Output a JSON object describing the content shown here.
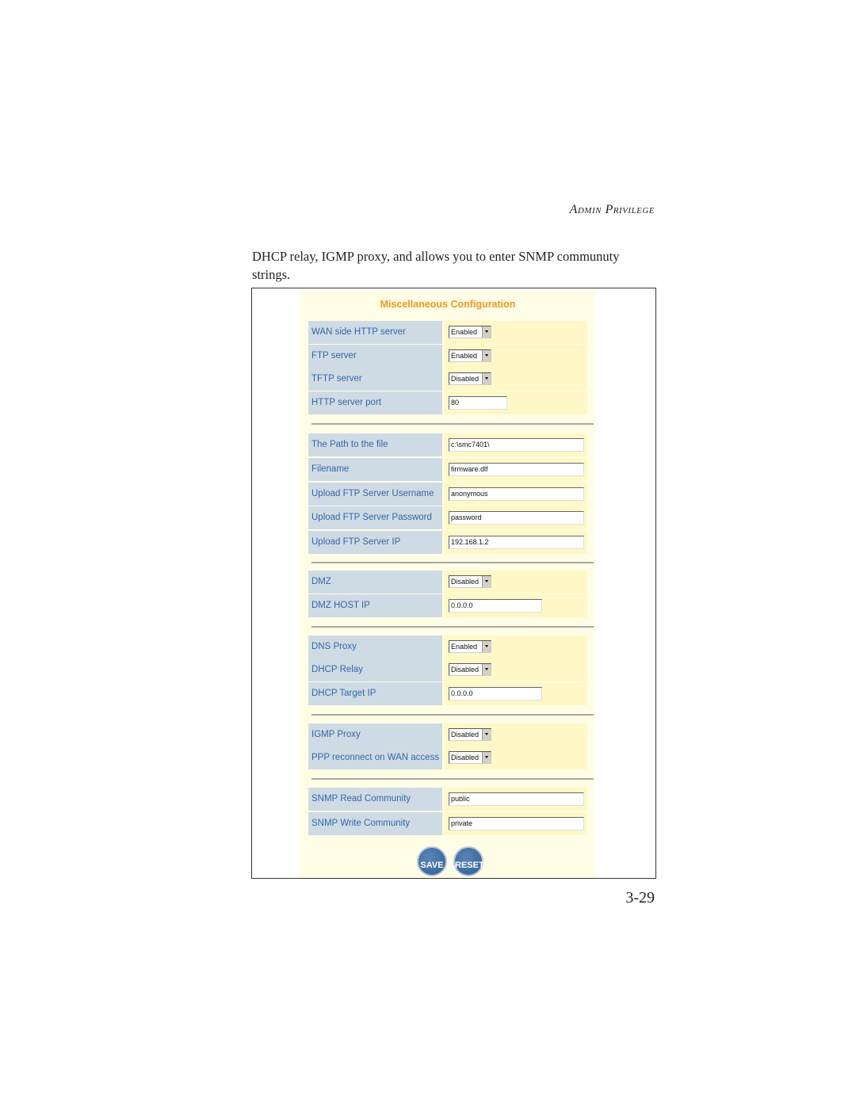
{
  "running_head": "Admin Privilege",
  "intro_text": "DHCP relay, IGMP proxy, and allows you to enter SNMP communuty strings.",
  "panel": {
    "title": "Miscellaneous Configuration",
    "rows": [
      {
        "label": "WAN side HTTP server",
        "type": "select",
        "value": "Enabled"
      },
      {
        "label": "FTP server",
        "type": "select",
        "value": "Enabled"
      },
      {
        "label": "TFTP server",
        "type": "select",
        "value": "Disabled"
      },
      {
        "label": "HTTP server port",
        "type": "text",
        "value": "80"
      },
      {
        "label": "The Path to the file",
        "type": "text",
        "value": "c:\\smc7401\\"
      },
      {
        "label": "Filename",
        "type": "text",
        "value": "firmware.dlf"
      },
      {
        "label": "Upload FTP Server Username",
        "type": "text",
        "value": "anonymous"
      },
      {
        "label": "Upload FTP Server Password",
        "type": "text",
        "value": "password"
      },
      {
        "label": "Upload FTP Server IP",
        "type": "text",
        "value": "192.168.1.2"
      },
      {
        "label": "DMZ",
        "type": "select",
        "value": "Disabled"
      },
      {
        "label": "DMZ HOST IP",
        "type": "text",
        "value": "0.0.0.0"
      },
      {
        "label": "DNS Proxy",
        "type": "select",
        "value": "Enabled"
      },
      {
        "label": "DHCP Relay",
        "type": "select",
        "value": "Disabled"
      },
      {
        "label": "DHCP Target IP",
        "type": "text",
        "value": "0.0.0.0"
      },
      {
        "label": "IGMP Proxy",
        "type": "select",
        "value": "Disabled"
      },
      {
        "label": "PPP reconnect on WAN access",
        "type": "select",
        "value": "Disabled"
      },
      {
        "label": "SNMP Read Community",
        "type": "text",
        "value": "public"
      },
      {
        "label": "SNMP Write Community",
        "type": "text",
        "value": "private"
      }
    ],
    "buttons": {
      "save": "SAVE",
      "reset": "RESET"
    }
  },
  "page_number": "3-29"
}
